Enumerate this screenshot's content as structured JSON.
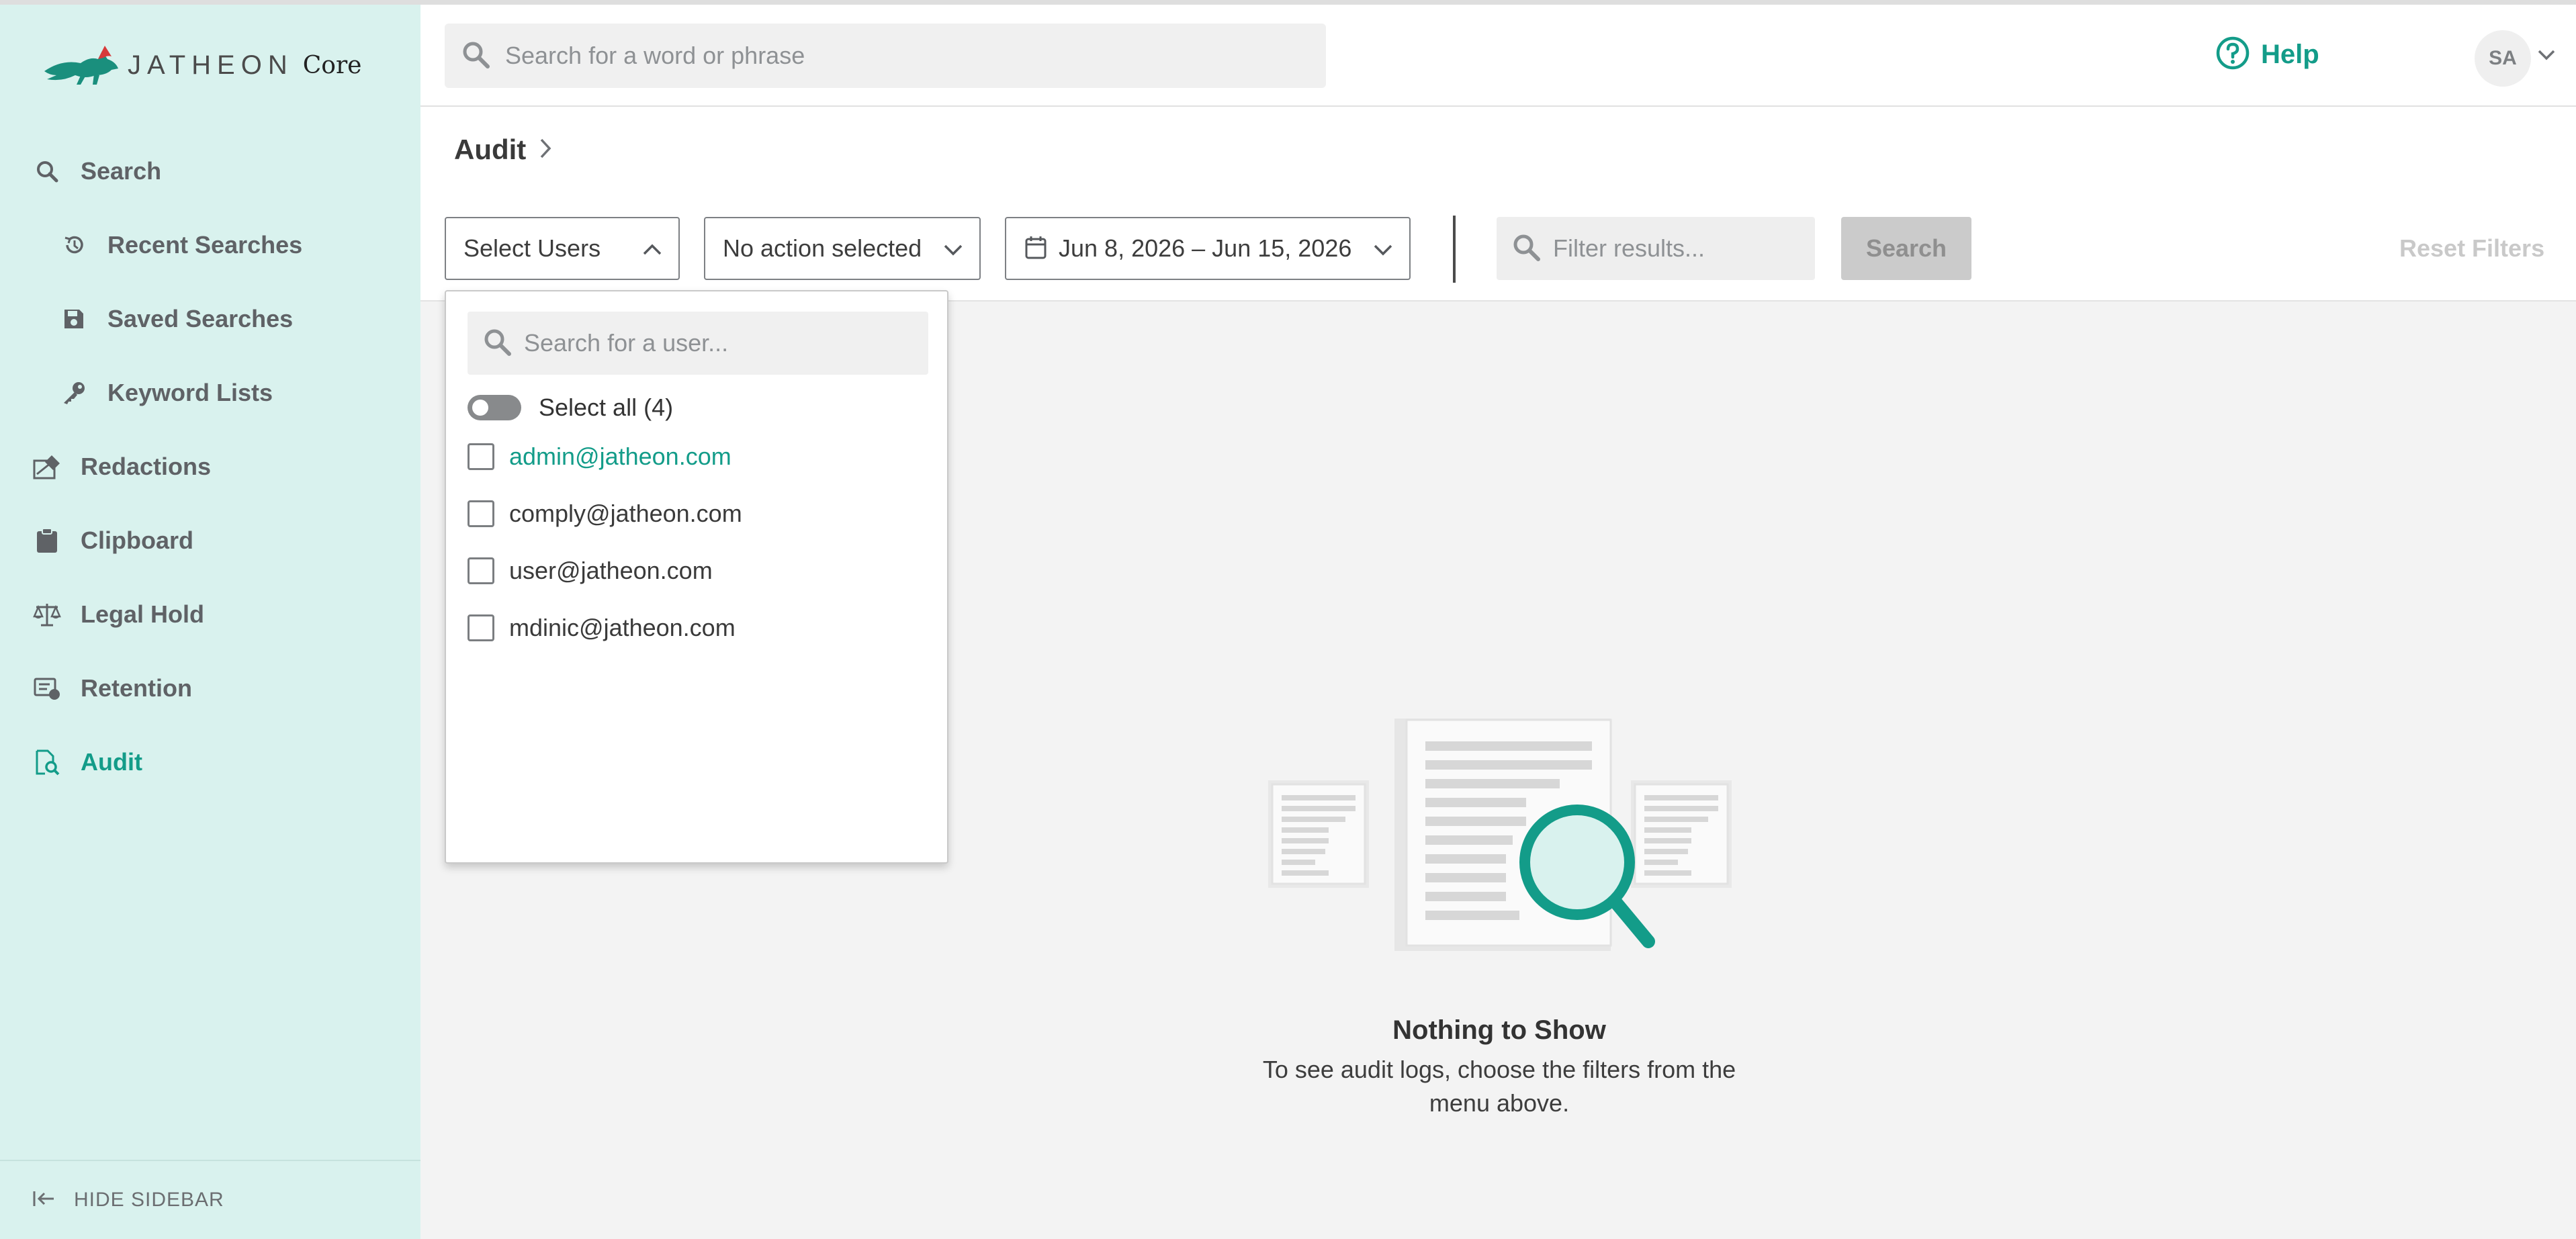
{
  "app": {
    "logo_text": "JATHEON",
    "logo_suffix": "Core",
    "brand_color": "#139c89"
  },
  "sidebar": {
    "items": [
      {
        "label": "Search",
        "icon": "search-icon"
      },
      {
        "label": "Recent Searches",
        "icon": "history-icon"
      },
      {
        "label": "Saved Searches",
        "icon": "save-icon"
      },
      {
        "label": "Keyword Lists",
        "icon": "key-icon"
      },
      {
        "label": "Redactions",
        "icon": "redaction-icon"
      },
      {
        "label": "Clipboard",
        "icon": "clipboard-icon"
      },
      {
        "label": "Legal Hold",
        "icon": "scale-icon"
      },
      {
        "label": "Retention",
        "icon": "retention-icon"
      },
      {
        "label": "Audit",
        "icon": "audit-icon",
        "active": true
      }
    ],
    "hide_label": "HIDE SIDEBAR"
  },
  "header": {
    "search_placeholder": "Search for a word or phrase",
    "help_label": "Help",
    "avatar_initials": "SA"
  },
  "page": {
    "breadcrumb": "Audit"
  },
  "filters": {
    "users_select": "Select Users",
    "action_select": "No action selected",
    "date_range": "Jun 8, 2026 – Jun 15, 2026",
    "filter_placeholder": "Filter results...",
    "search_button": "Search",
    "reset_button": "Reset Filters"
  },
  "users_dropdown": {
    "search_placeholder": "Search for a user...",
    "select_all_label": "Select all (4)",
    "users": [
      "admin@jatheon.com",
      "comply@jatheon.com",
      "user@jatheon.com",
      "mdinic@jatheon.com"
    ]
  },
  "empty_state": {
    "title": "Nothing to Show",
    "description": "To see audit logs, choose the filters from the menu above."
  }
}
